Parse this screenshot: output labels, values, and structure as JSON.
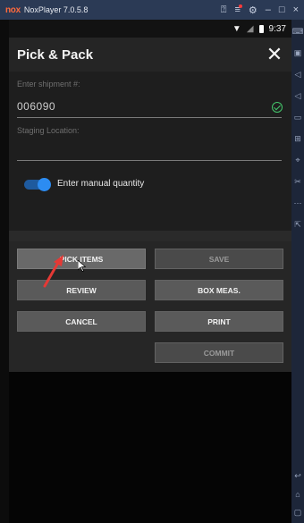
{
  "emulator": {
    "logo": "nox",
    "title": "NoxPlayer 7.0.5.8",
    "controls": [
      "help-icon",
      "menu-icon",
      "settings-icon",
      "minimize-icon",
      "maximize-icon",
      "close-icon"
    ],
    "toolbar_icons": [
      "keyboard-icon",
      "screenshot-icon",
      "volume-up-icon",
      "volume-down-icon",
      "display-icon",
      "apk-icon",
      "location-icon",
      "scissor-icon",
      "more-icon",
      "expand-icon",
      "back-icon",
      "home-icon",
      "recents-icon"
    ]
  },
  "status_bar": {
    "time": "9:37"
  },
  "app": {
    "title": "Pick & Pack",
    "close_symbol": "✕"
  },
  "form": {
    "shipment_label": "Enter shipment #:",
    "shipment_value": "006090",
    "staging_label": "Staging Location:",
    "staging_value": "",
    "manual_quantity_label": "Enter manual quantity",
    "manual_quantity_enabled": true
  },
  "buttons": {
    "pick_items": "PICK ITEMS",
    "save": "SAVE",
    "review": "REVIEW",
    "box_meas": "BOX MEAS.",
    "cancel": "CANCEL",
    "print": "PRINT",
    "commit": "COMMIT"
  },
  "colors": {
    "accent": "#2c8cf2",
    "success": "#44c76b",
    "annotation_arrow": "#e53935",
    "nox_bar": "#2b3a55"
  }
}
